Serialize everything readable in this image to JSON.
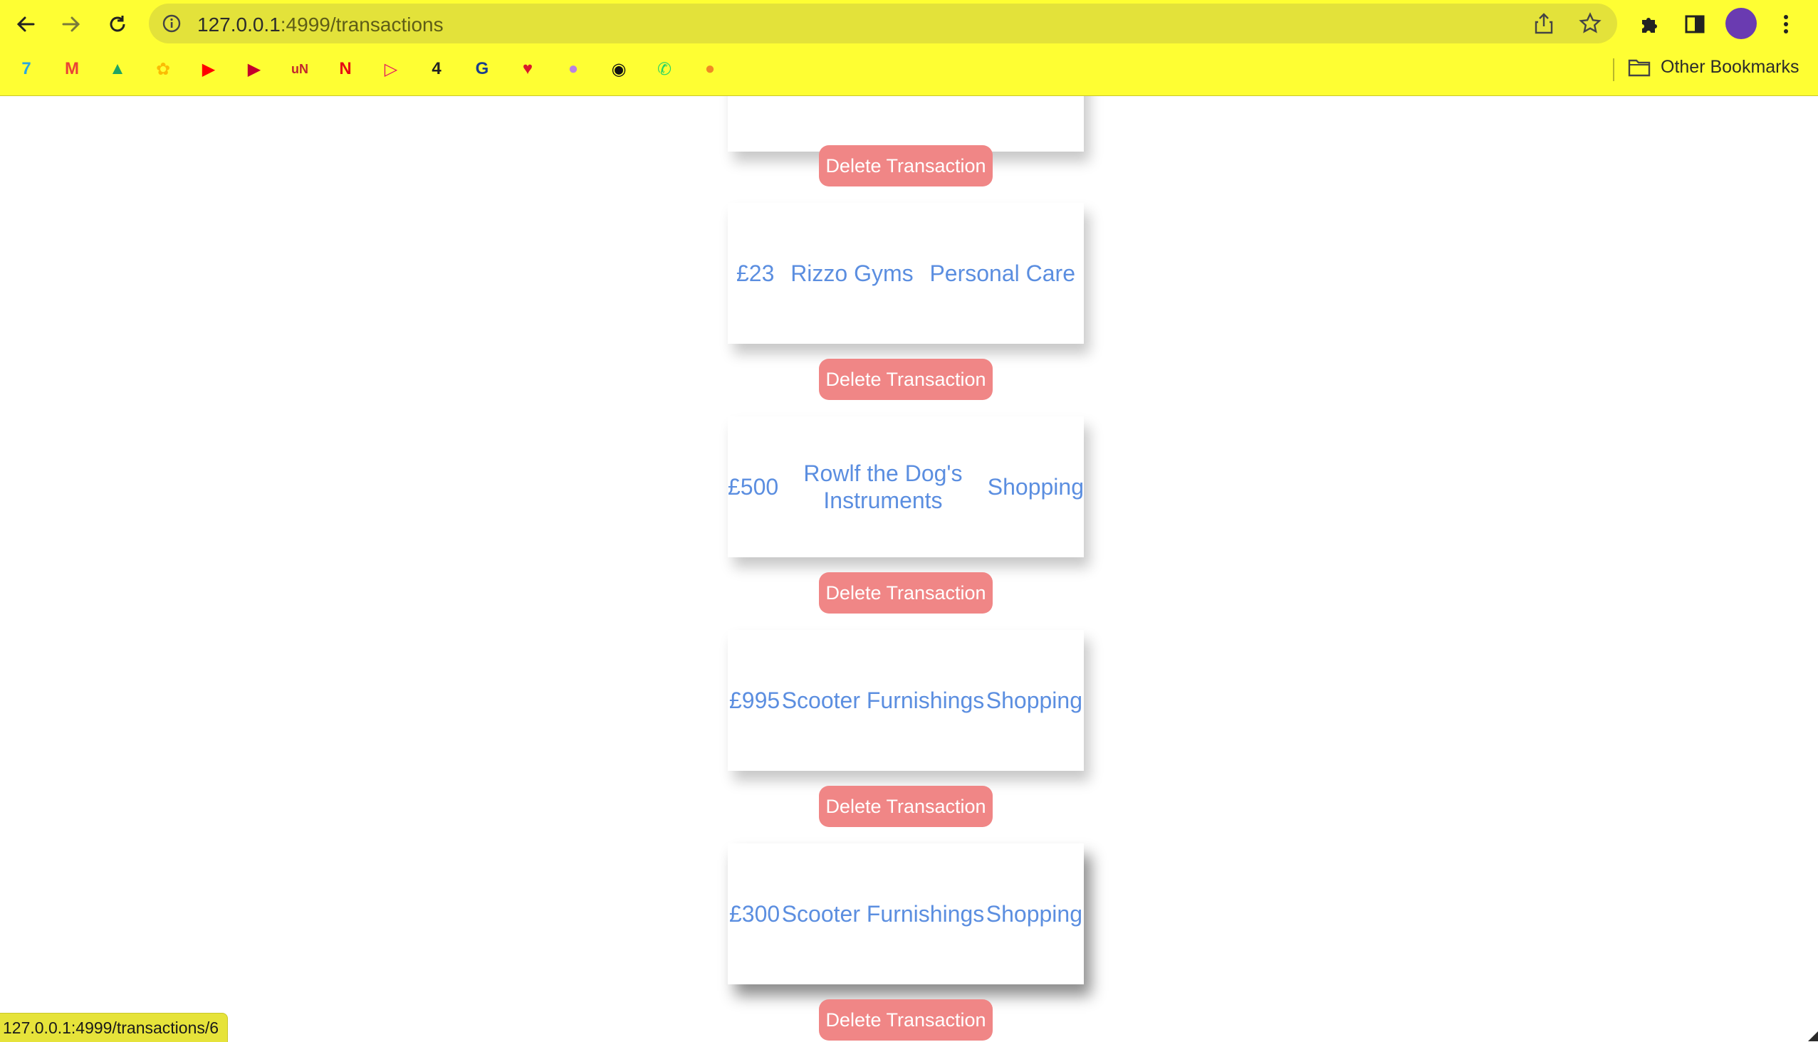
{
  "browser": {
    "url_host": "127.0.0.1",
    "url_rest": ":4999/transactions",
    "other_bookmarks": "Other Bookmarks",
    "bookmarks": [
      {
        "icon": "dart-icon",
        "color": "#2aa7e0",
        "glyph": "7"
      },
      {
        "icon": "gmail-icon",
        "color": "#ea4335",
        "glyph": "M"
      },
      {
        "icon": "google-drive-icon",
        "color": "#1fa463",
        "glyph": "▲"
      },
      {
        "icon": "google-photos-icon",
        "color": "#fbbc04",
        "glyph": "✿"
      },
      {
        "icon": "youtube-icon",
        "color": "#ff0000",
        "glyph": "▶"
      },
      {
        "icon": "play-circle-icon",
        "color": "#c4002b",
        "glyph": "▶"
      },
      {
        "icon": "un-icon",
        "color": "#c1272d",
        "glyph": "uN"
      },
      {
        "icon": "netflix-icon",
        "color": "#e50914",
        "glyph": "N"
      },
      {
        "icon": "play-arrow-icon",
        "color": "#e5185d",
        "glyph": "▷"
      },
      {
        "icon": "channel4-icon",
        "color": "#222222",
        "glyph": "4"
      },
      {
        "icon": "circle-g-icon",
        "color": "#1b3f8b",
        "glyph": "G"
      },
      {
        "icon": "red-heart-icon",
        "color": "#d9182b",
        "glyph": "♥"
      },
      {
        "icon": "colorful-ball-icon",
        "color": "#b983e0",
        "glyph": "●"
      },
      {
        "icon": "globe-icon",
        "color": "#111111",
        "glyph": "◉"
      },
      {
        "icon": "whatsapp-icon",
        "color": "#25d366",
        "glyph": "✆"
      },
      {
        "icon": "orange-blob-icon",
        "color": "#f08a24",
        "glyph": "●"
      }
    ]
  },
  "transactions": [
    {
      "amount": "£23",
      "merchant": "Rizzo Gyms",
      "category": "Personal Care"
    },
    {
      "amount": "£500",
      "merchant": "Rowlf the Dog's Instruments",
      "category": "Shopping"
    },
    {
      "amount": "£995",
      "merchant": "Scooter Furnishings",
      "category": "Shopping"
    },
    {
      "amount": "£300",
      "merchant": "Scooter Furnishings",
      "category": "Shopping"
    }
  ],
  "delete_label": "Delete Transaction",
  "status_url": "127.0.0.1:4999/transactions/6"
}
